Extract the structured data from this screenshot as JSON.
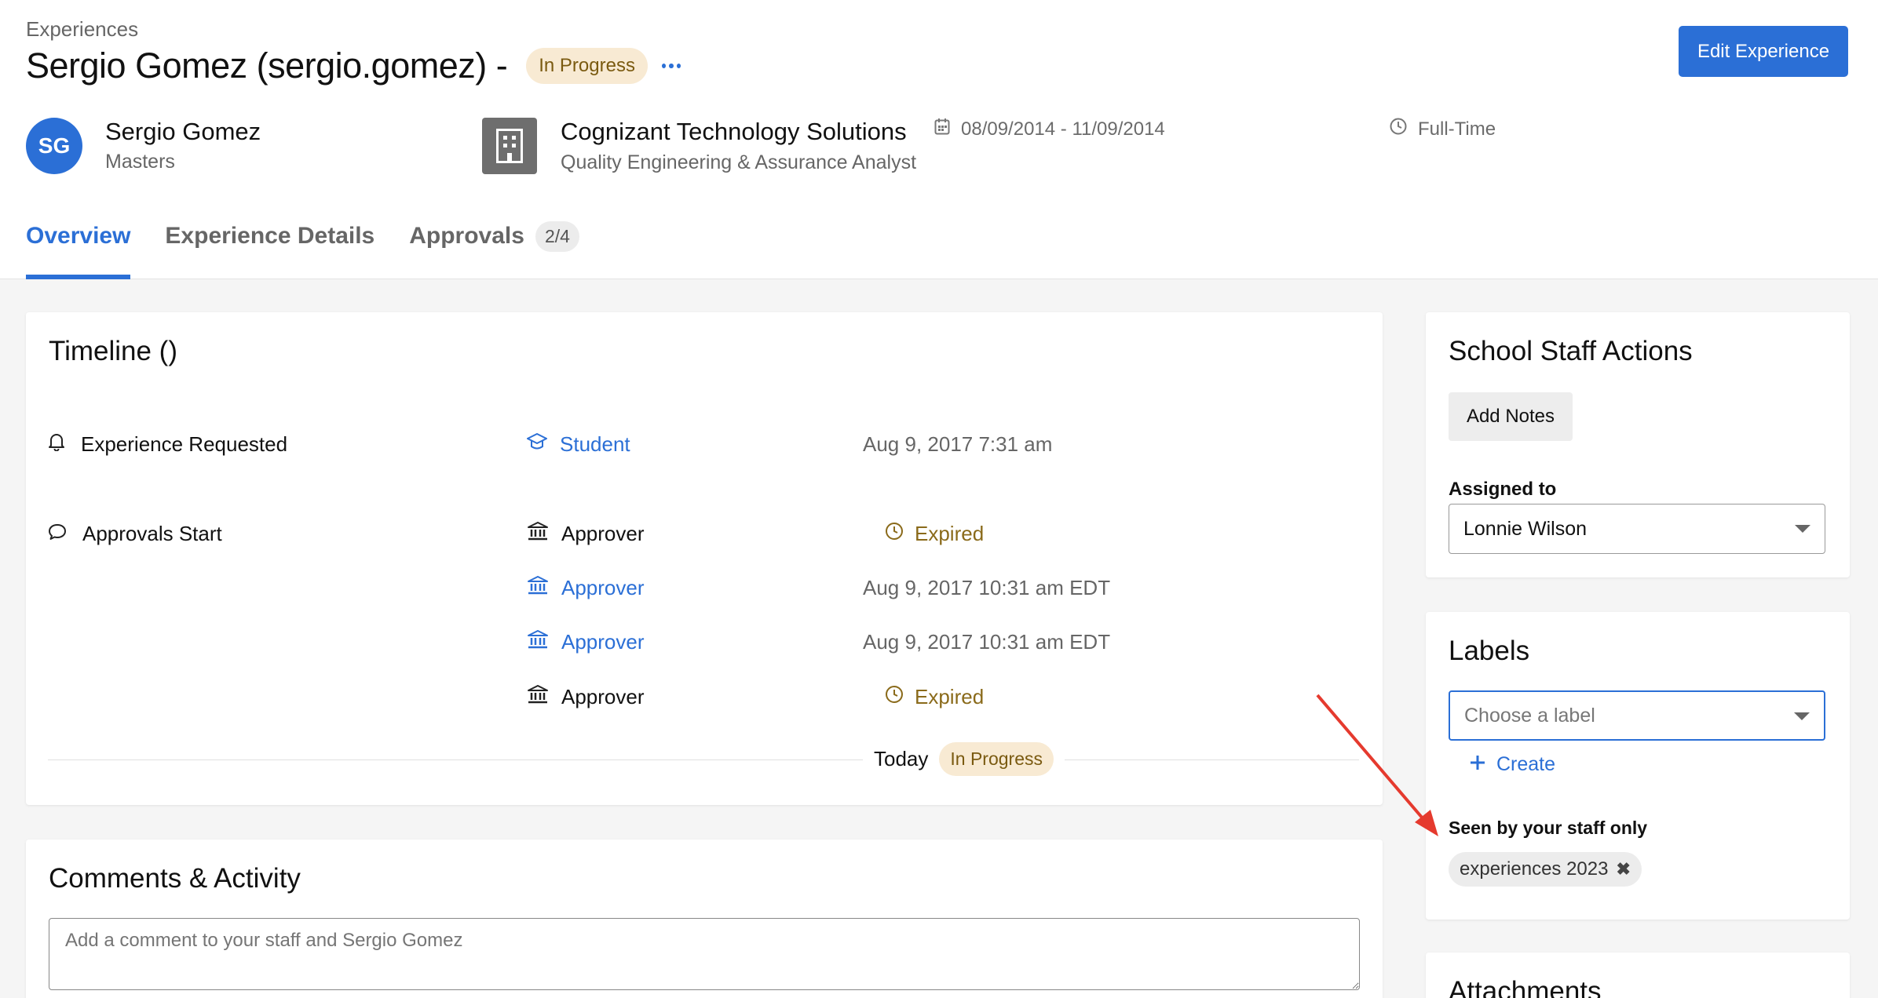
{
  "header": {
    "breadcrumb": "Experiences",
    "title": "Sergio Gomez (sergio.gomez) -",
    "status": "In Progress",
    "edit_button": "Edit Experience"
  },
  "student": {
    "initials": "SG",
    "name": "Sergio Gomez",
    "degree": "Masters"
  },
  "employer": {
    "company": "Cognizant Technology Solutions",
    "job_title": "Quality Engineering & Assurance Analyst",
    "dates": "08/09/2014 - 11/09/2014",
    "employment_type": "Full-Time"
  },
  "tabs": [
    {
      "label": "Overview",
      "active": true
    },
    {
      "label": "Experience Details"
    },
    {
      "label": "Approvals",
      "count": "2/4"
    }
  ],
  "timeline": {
    "title": "Timeline ()",
    "events": [
      {
        "event": "Experience Requested",
        "actor": "Student",
        "time": "Aug 9, 2017 7:31 am"
      },
      {
        "event": "Approvals Start",
        "actor": "Approver",
        "status": "Expired"
      },
      {
        "actor": "Approver",
        "time": "Aug 9, 2017 10:31 am EDT"
      },
      {
        "actor": "Approver",
        "time": "Aug 9, 2017 10:31 am EDT"
      },
      {
        "actor": "Approver",
        "status": "Expired"
      }
    ],
    "today_label": "Today",
    "today_status": "In Progress"
  },
  "comments": {
    "title": "Comments & Activity",
    "placeholder": "Add a comment to your staff and Sergio Gomez"
  },
  "staff_actions": {
    "title": "School Staff Actions",
    "add_notes": "Add Notes",
    "assigned_label": "Assigned to",
    "assigned_value": "Lonnie Wilson"
  },
  "labels": {
    "title": "Labels",
    "placeholder": "Choose a label",
    "create": "Create",
    "seen_by": "Seen by your staff only",
    "tag": "experiences 2023"
  },
  "attachments": {
    "title": "Attachments"
  },
  "colors": {
    "primary": "#2b6fd6",
    "status_bg": "#f8ead3",
    "expired": "#8a6a1a",
    "annotation_arrow": "#e53a2e"
  }
}
